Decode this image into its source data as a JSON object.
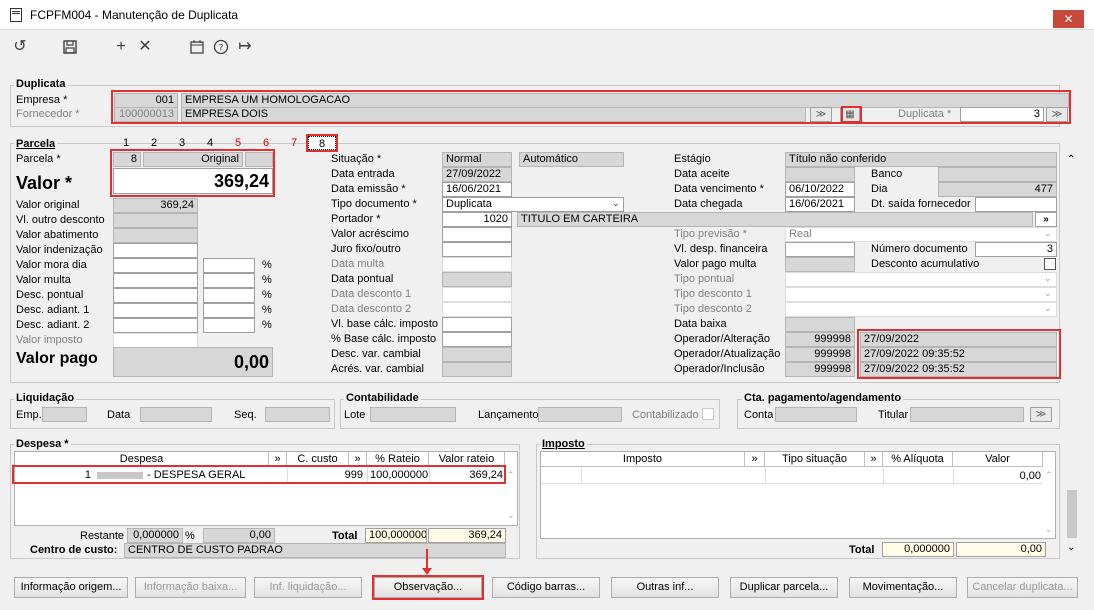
{
  "window": {
    "title": "FCPFM004 - Manutenção de Duplicata",
    "btn_min": "–",
    "btn_max": "□",
    "btn_close": "✕"
  },
  "duplicata": {
    "title": "Duplicata",
    "empresa_label": "Empresa *",
    "empresa_code": "001",
    "empresa_name": "EMPRESA UM HOMOLOGACAO",
    "fornecedor_label": "Fornecedor *",
    "fornecedor_code": "100000013",
    "fornecedor_name": "EMPRESA DOIS",
    "duplicata_label": "Duplicata *",
    "duplicata_value": "3"
  },
  "parcela": {
    "title": "Parcela",
    "tabs": [
      "1",
      "2",
      "3",
      "4",
      "5",
      "6",
      "7",
      "8"
    ],
    "parcela_label": "Parcela *",
    "parcela_num": "8",
    "parcela_type": "Original",
    "valor_label": "Valor *",
    "valor": "369,24",
    "left_labels": [
      "Valor original",
      "Vl. outro desconto",
      "Valor abatimento",
      "Valor indenização",
      "Valor mora dia",
      "Valor multa",
      "Desc. pontual",
      "Desc. adiant. 1",
      "Desc. adiant. 2",
      "Valor imposto"
    ],
    "valor_original": "369,24",
    "pct": "%",
    "valor_pago_label": "Valor pago",
    "valor_pago": "0,00",
    "mid_labels": [
      "Situação *",
      "Data entrada",
      "Data emissão *",
      "Tipo documento *",
      "Portador *",
      "Valor acréscimo",
      "Juro fixo/outro",
      "Data multa",
      "Data pontual",
      "Data desconto 1",
      "Data desconto 2",
      "Vl. base cálc. imposto",
      "% Base cálc. imposto",
      "Desc. var. cambial",
      "Acrés. var. cambial"
    ],
    "situacao": "Normal",
    "situacao2": "Automático",
    "data_entrada": "27/09/2022",
    "data_emissao": "16/06/2021",
    "tipo_documento": "Duplicata",
    "portador_code": "1020",
    "portador_name": "TITULO EM CARTEIRA",
    "right_labels": [
      "Estágio",
      "Data aceite",
      "Data vencimento *",
      "Data chegada",
      "Tipo previsão *",
      "Vl. desp. financeira",
      "Valor pago multa",
      "Tipo pontual",
      "Tipo desconto 1",
      "Tipo desconto 2",
      "Data baixa",
      "Operador/Alteração",
      "Operador/Atualização",
      "Operador/Inclusão"
    ],
    "estagio": "Título não conferido",
    "banco_label": "Banco",
    "dia_label": "Dia",
    "dia": "477",
    "data_vencimento": "06/10/2022",
    "data_chegada": "16/06/2021",
    "dt_saida_label": "Dt. saída fornecedor",
    "tipo_previsao": "Real",
    "numero_doc_label": "Número documento",
    "numero_doc": "3",
    "desconto_acum_label": "Desconto acumulativo",
    "op_alteracao": "999998",
    "op_alteracao_dt": "27/09/2022",
    "op_atualizacao": "999998",
    "op_atualizacao_dt": "27/09/2022 09:35:52",
    "op_inclusao": "999998",
    "op_inclusao_dt": "27/09/2022 09:35:52"
  },
  "liquidacao": {
    "title": "Liquidação",
    "emp": "Emp.",
    "data": "Data",
    "seq": "Seq."
  },
  "contabilidade": {
    "title": "Contabilidade",
    "lote": "Lote",
    "lancamento": "Lançamento",
    "contabilizado": "Contabilizado"
  },
  "cta": {
    "title": "Cta. pagamento/agendamento",
    "conta": "Conta",
    "titular": "Titular"
  },
  "despesa": {
    "title": "Despesa *",
    "cols": [
      "Despesa",
      "C. custo",
      "% Rateio",
      "Valor rateio"
    ],
    "row": {
      "num": "1",
      "desc": "- DESPESA GERAL",
      "ccusto": "999",
      "rateio": "100,000000",
      "valor": "369,24"
    },
    "restante_label": "Restante",
    "restante_pct": "0,000000",
    "restante_val": "0,00",
    "total_label": "Total",
    "total_pct": "100,000000",
    "total_val": "369,24",
    "centro_label": "Centro de custo:",
    "centro": "CENTRO DE CUSTO PADRAO"
  },
  "imposto": {
    "title": "Imposto",
    "cols": [
      "Imposto",
      "Tipo situação",
      "% Alíquota",
      "Valor"
    ],
    "row_valor": "0,00",
    "total_label": "Total",
    "total_pct": "0,000000",
    "total_val": "0,00"
  },
  "buttons": [
    "Informação origem...",
    "Informação baixa...",
    "Inf. liquidação...",
    "Observação...",
    "Código barras...",
    "Outras inf...",
    "Duplicar parcela...",
    "Movimentação...",
    "Cancelar duplicata..."
  ]
}
